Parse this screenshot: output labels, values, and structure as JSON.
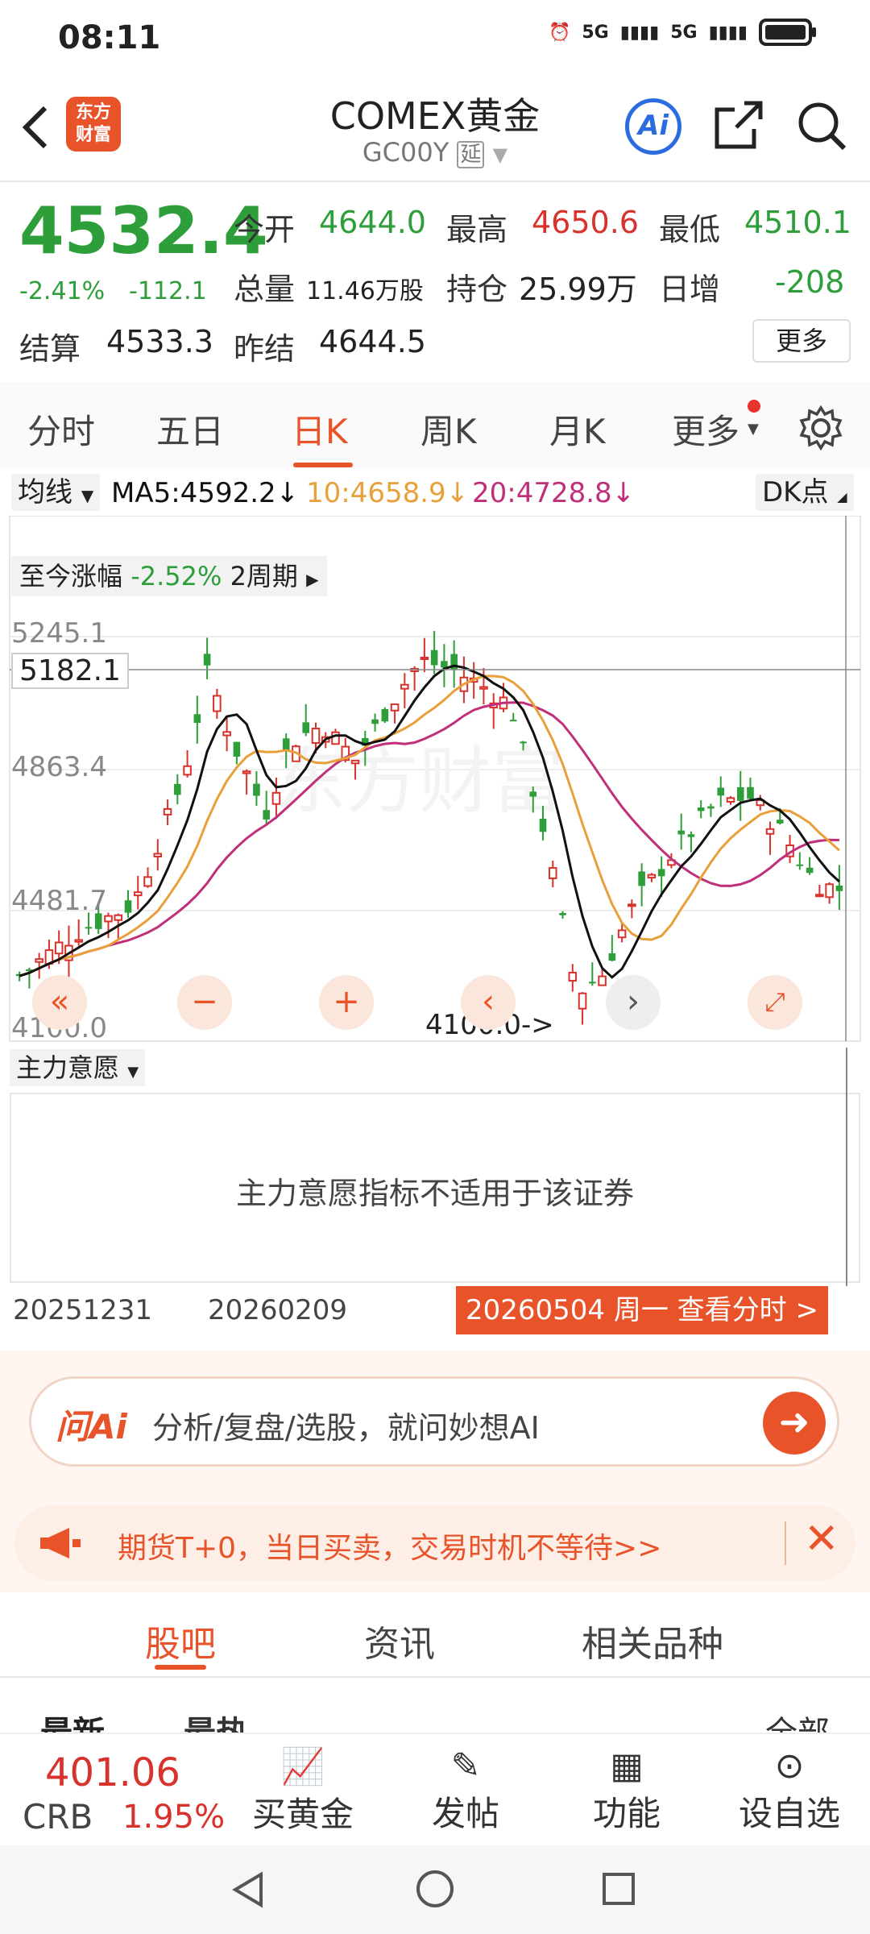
{
  "status": {
    "time": "08:11",
    "net1": "5G",
    "net2": "5G"
  },
  "header": {
    "title": "COMEX黄金",
    "subtitle": "GC00Y",
    "delay_tag": "延",
    "logo_line1": "东方",
    "logo_line2": "财富",
    "ai_label": "Ai"
  },
  "quote": {
    "price": "4532.4",
    "change_pct": "-2.41%",
    "change": "-112.1",
    "open_label": "今开",
    "open": "4644.0",
    "high_label": "最高",
    "high": "4650.6",
    "low_label": "最低",
    "low": "4510.1",
    "volume_label": "总量",
    "volume": "11.46万股",
    "oi_label": "持仓",
    "oi": "25.99万",
    "daily_inc_label": "日增",
    "daily_inc": "-208",
    "settle_label": "结算",
    "settle": "4533.3",
    "prev_settle_label": "昨结",
    "prev_settle": "4644.5",
    "more_button": "更多"
  },
  "tabs": [
    "分时",
    "五日",
    "日K",
    "周K",
    "月K",
    "更多"
  ],
  "ma_row": {
    "selector": "均线",
    "ma5": "MA5:4592.2↓",
    "ma10": "10:4658.9↓",
    "ma20": "20:4728.8↓",
    "dk": "DK点"
  },
  "period_info": {
    "label": "至今涨幅",
    "value": "-2.52%",
    "period": "2周期"
  },
  "axis": {
    "y_labels": [
      "5245.1",
      "4863.4",
      "4481.7",
      "4100.0"
    ],
    "crosshair_price": "5182.1",
    "min_marker": "4100.0->",
    "dates": [
      "20251231",
      "20260209"
    ],
    "selected_date": "20260504 周一 查看分时 >"
  },
  "indicator": {
    "selector": "主力意愿",
    "message": "主力意愿指标不适用于该证券"
  },
  "ai_bar": {
    "brand": "问Ai",
    "placeholder": "分析/复盘/选股，就问妙想AI"
  },
  "ad_bar": {
    "text": "期货T+0，当日买卖，交易时机不等待>>"
  },
  "bottom_tabs": [
    "股吧",
    "资讯",
    "相关品种"
  ],
  "sub_filters": {
    "left1": "最新",
    "left2": "最热",
    "right": "全部"
  },
  "toolbar": {
    "crb_value": "401.06",
    "crb_label": "CRB",
    "crb_pct": "1.95%",
    "items": [
      "买黄金",
      "发帖",
      "功能",
      "设自选"
    ]
  },
  "colors": {
    "up": "#d8322c",
    "down": "#2e9e3a",
    "accent": "#e8532a",
    "ma5": "#111111",
    "ma10": "#e8a03a",
    "ma20": "#c0307a"
  }
}
